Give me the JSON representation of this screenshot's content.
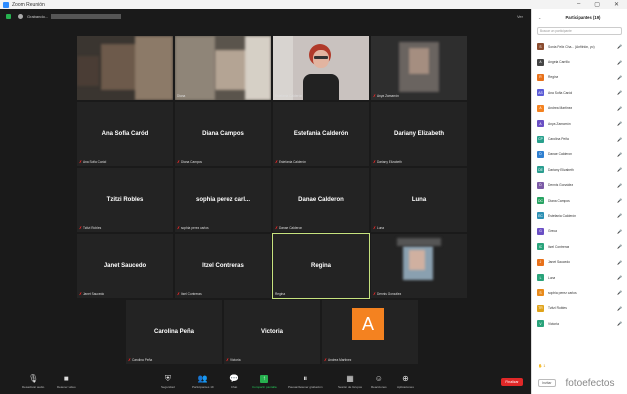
{
  "window": {
    "title": "Zoom Reunión"
  },
  "topbar": {
    "meeting_label": "Grabando...",
    "view_label": "Ver"
  },
  "gallery": {
    "video_tiles": [
      {
        "name": ""
      },
      {
        "name": "Diana"
      },
      {
        "name": "Estefania Calderón"
      },
      {
        "name": "Anya Zamarrón"
      }
    ],
    "name_tiles": [
      {
        "display": "Ana Sofia Caród",
        "label": "Ana Sofia Caród"
      },
      {
        "display": "Diana Campos",
        "label": "Diana Campos"
      },
      {
        "display": "Estefania Calderón",
        "label": "Estefania Calderón"
      },
      {
        "display": "Dariany Elizabeth",
        "label": "Dariany Elizabeth"
      },
      {
        "display": "Tzitzi Robles",
        "label": "Tzitzi Robles"
      },
      {
        "display": "sophia perez carl...",
        "label": "sophia perez carlos"
      },
      {
        "display": "Danae Calderon",
        "label": "Danae Calderon"
      },
      {
        "display": "Luna",
        "label": "Luna"
      },
      {
        "display": "Janet Saucedo",
        "label": "Janet Saucedo"
      },
      {
        "display": "Itzel Contreras",
        "label": "Itzel Contreras"
      },
      {
        "display": "Regina",
        "label": "Regina"
      },
      {
        "display": "",
        "label": "Dennis González"
      },
      {
        "display": "Carolina Peña",
        "label": "Carolina Peña"
      },
      {
        "display": "Victoria",
        "label": "Victoria"
      },
      {
        "display": "",
        "label": "Andrea Martinez",
        "avatar_letter": "A"
      }
    ]
  },
  "toolbar": {
    "audio": "Desactivar audio",
    "video": "Detener video",
    "security": "Seguridad",
    "participants": "Participantes",
    "participants_count": "19",
    "chat": "Chat",
    "share": "Compartir pantalla",
    "record": "Pausar/detener grabación",
    "breakout": "Sesión de Grupos",
    "reactions": "Reacciones",
    "apps": "Aplicaciones",
    "end": "Finalizar"
  },
  "panel": {
    "title": "Participantes (19)",
    "search_placeholder": "Buscar un participante",
    "participants": [
      {
        "initial": "S",
        "name": "Sonia Felix Cha... (Anfitrión, yo)",
        "color": "#8a4b2e"
      },
      {
        "initial": "A",
        "name": "Angela Carrillo",
        "color": "#444444"
      },
      {
        "initial": "R",
        "name": "Regina",
        "color": "#e8711a"
      },
      {
        "initial": "AS",
        "name": "Ana Sofia Caród",
        "color": "#5b5bd6"
      },
      {
        "initial": "A",
        "name": "Andrea Martinez",
        "color": "#f48220"
      },
      {
        "initial": "A",
        "name": "Anya Zamarrón",
        "color": "#6a4fc4"
      },
      {
        "initial": "CP",
        "name": "Carolina Peña",
        "color": "#28a08c"
      },
      {
        "initial": "D",
        "name": "Danae Calderon",
        "color": "#2f7fd0"
      },
      {
        "initial": "DE",
        "name": "Dariany Elizabeth",
        "color": "#2a9d8f"
      },
      {
        "initial": "D",
        "name": "Dennis González",
        "color": "#7b5aa6"
      },
      {
        "initial": "DC",
        "name": "Diana Campos",
        "color": "#27a362"
      },
      {
        "initial": "EC",
        "name": "Estefania Calderón",
        "color": "#2b8fb3"
      },
      {
        "initial": "G",
        "name": "Greca",
        "color": "#6a4fc4"
      },
      {
        "initial": "IC",
        "name": "Itzel Contreras",
        "color": "#29a37a"
      },
      {
        "initial": "J",
        "name": "Janet Saucedo",
        "color": "#e8711a"
      },
      {
        "initial": "L",
        "name": "Luna",
        "color": "#29a37a"
      },
      {
        "initial": "S",
        "name": "sophia perez carlos",
        "color": "#e88a1a"
      },
      {
        "initial": "TR",
        "name": "Tzitzi Robles",
        "color": "#e0a31a"
      },
      {
        "initial": "V",
        "name": "Victoria",
        "color": "#29a37a"
      }
    ],
    "raise_hand": "1",
    "invite": "Invitar",
    "watermark": "fotoefectos"
  }
}
